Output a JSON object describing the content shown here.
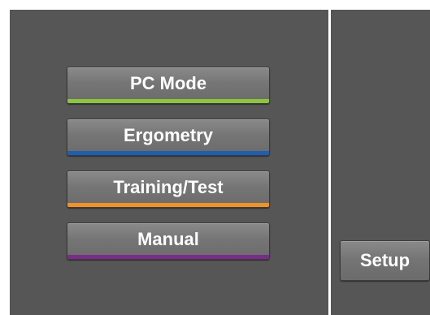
{
  "menu": {
    "items": [
      {
        "label": "PC Mode",
        "accent_color": "#8cc63f"
      },
      {
        "label": "Ergometry",
        "accent_color": "#1f5fb0"
      },
      {
        "label": "Training/Test",
        "accent_color": "#f0922a"
      },
      {
        "label": "Manual",
        "accent_color": "#7a2c8a"
      }
    ]
  },
  "side": {
    "setup_label": "Setup"
  },
  "colors": {
    "panel_background": "#565656",
    "divider": "#ffffff",
    "button_text": "#ffffff"
  }
}
